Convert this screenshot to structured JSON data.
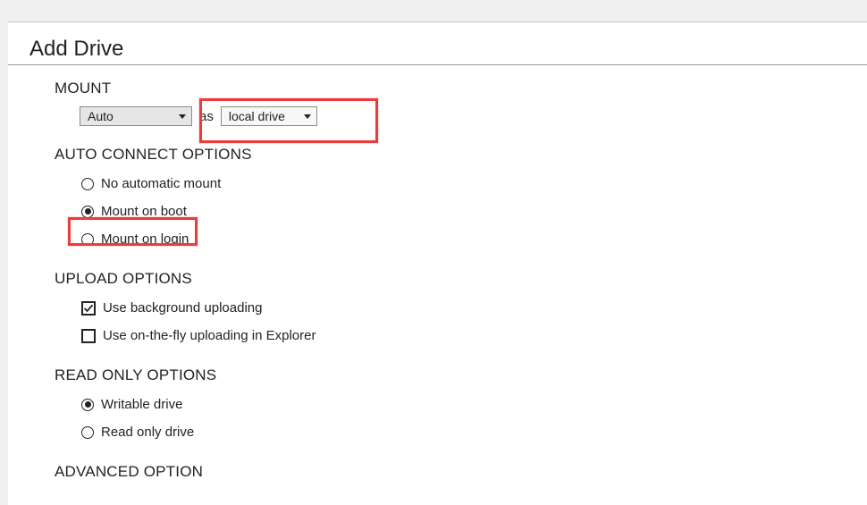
{
  "title": "Add Drive",
  "mount": {
    "heading": "MOUNT",
    "letter_value": "Auto",
    "as_word": "as",
    "type_value": "local drive"
  },
  "auto_connect": {
    "heading": "AUTO CONNECT OPTIONS",
    "options": {
      "none": {
        "label": "No automatic mount",
        "checked": false
      },
      "boot": {
        "label": "Mount on boot",
        "checked": true
      },
      "login": {
        "label": "Mount on login",
        "checked": false
      }
    }
  },
  "upload": {
    "heading": "UPLOAD OPTIONS",
    "background": {
      "label": "Use background uploading",
      "checked": true
    },
    "on_the_fly": {
      "label": "Use on-the-fly uploading in Explorer",
      "checked": false
    }
  },
  "read_only": {
    "heading": "READ ONLY OPTIONS",
    "writable": {
      "label": "Writable drive",
      "checked": true
    },
    "readonly": {
      "label": "Read only drive",
      "checked": false
    }
  },
  "advanced": {
    "heading": "ADVANCED OPTION"
  }
}
